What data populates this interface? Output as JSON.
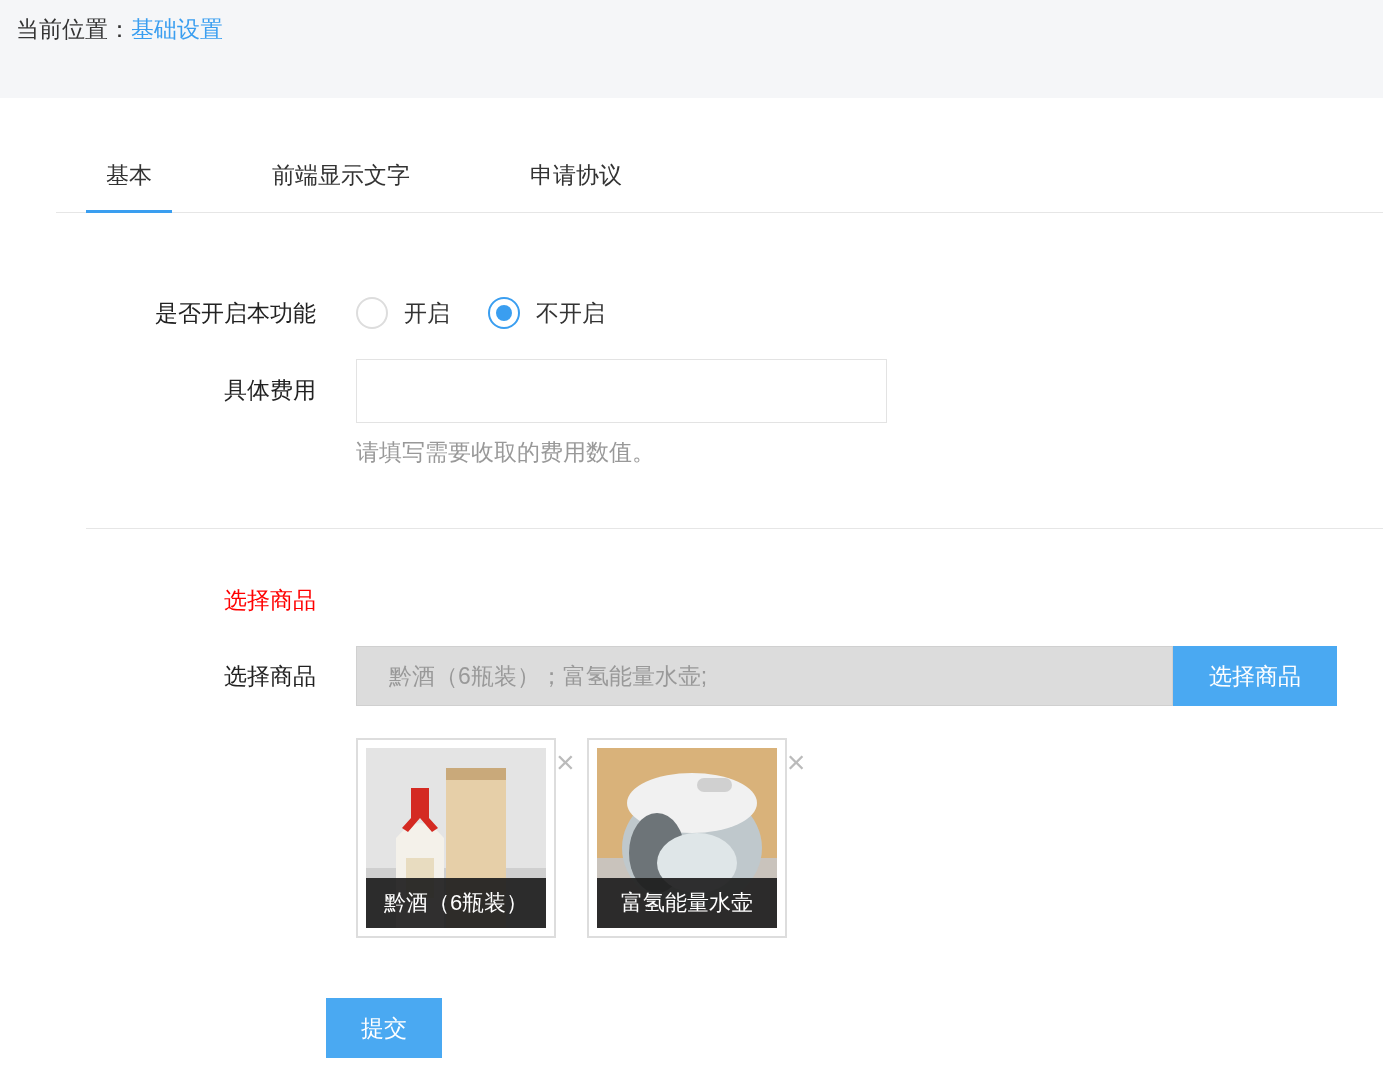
{
  "breadcrumb": {
    "label": "当前位置：",
    "current": "基础设置"
  },
  "tabs": [
    {
      "label": "基本",
      "selected": true
    },
    {
      "label": "前端显示文字",
      "selected": false
    },
    {
      "label": "申请协议",
      "selected": false
    }
  ],
  "switch": {
    "label": "是否开启本功能",
    "options": [
      {
        "label": "开启",
        "selected": false
      },
      {
        "label": "不开启",
        "selected": true
      }
    ]
  },
  "fee": {
    "label": "具体费用",
    "hint": "请填写需要收取的费用数值。"
  },
  "section_title": "选择商品",
  "goods": {
    "label": "选择商品",
    "value": "黔酒（6瓶装）；富氢能量水壶;",
    "button": "选择商品"
  },
  "products": [
    {
      "kind": "bottle",
      "name": "黔酒（6瓶装）",
      "remove": "×"
    },
    {
      "kind": "kettle",
      "name": "富氢能量水壶",
      "remove": "×"
    }
  ],
  "submit": "提交"
}
